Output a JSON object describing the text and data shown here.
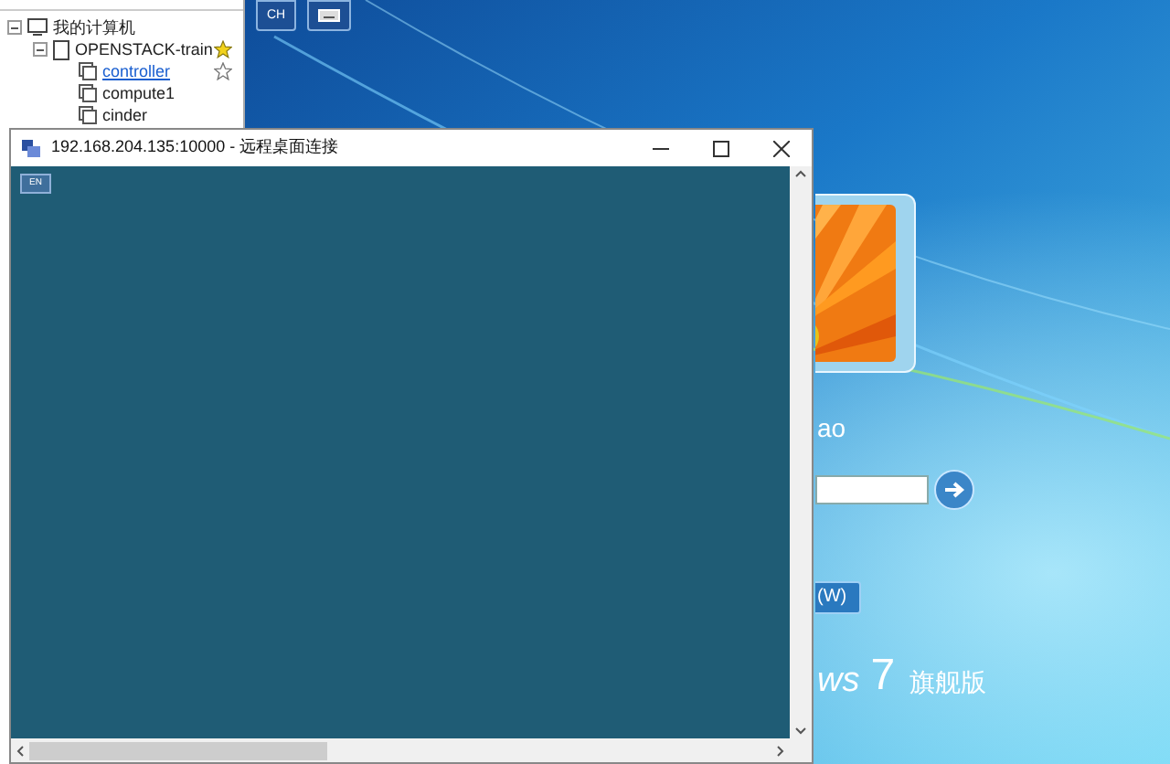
{
  "tree": {
    "items": [
      {
        "label": "我的计算机",
        "expanded": true,
        "kind": "computer",
        "children": [
          {
            "label": "OPENSTACK-train",
            "expanded": true,
            "kind": "document",
            "favorite": true,
            "children": [
              {
                "label": "controller",
                "kind": "session",
                "selected": true,
                "favorite": false
              },
              {
                "label": "compute1",
                "kind": "session",
                "selected": false
              },
              {
                "label": "cinder",
                "kind": "session",
                "selected": false
              }
            ]
          }
        ]
      }
    ]
  },
  "toolbar": [
    {
      "kind": "text",
      "label": "CH"
    },
    {
      "kind": "keyboard"
    }
  ],
  "rdp_window": {
    "title": "192.168.204.135:10000 - 远程桌面连接",
    "badge": "EN"
  },
  "remote_screen": {
    "user_name": "ao",
    "button_label": "(W)",
    "brand": "ws",
    "version": "7",
    "edition": "旗舰版"
  }
}
